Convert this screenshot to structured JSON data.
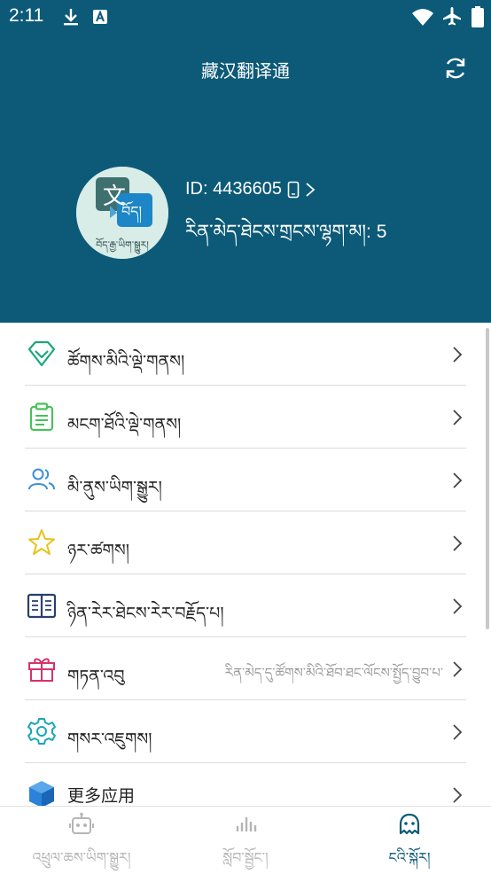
{
  "status_bar": {
    "time": "2:11",
    "icons": [
      "download-icon",
      "a-box-icon",
      "wifi-icon",
      "airplane-icon",
      "battery-icon"
    ]
  },
  "header": {
    "title": "藏汉翻译通",
    "refresh_icon": "refresh-icon",
    "avatar_caption": "བོད་རྒྱ་ཡིག་སྒྱུར།",
    "avatar_icon_chinese": "文",
    "avatar_icon_tibetan": "བོད།",
    "user_id_label": "ID: 4436605",
    "user_points_label": "རིན་མེད་ཐེངས་གྲངས་ལྷག་མ།: 5"
  },
  "menu": {
    "items": [
      {
        "name": "vip-services",
        "icon": "diamond-icon",
        "label": "ཚོགས་མིའི་ལྡེ་གནས།",
        "color": "#1aa77a"
      },
      {
        "name": "purchase-records",
        "icon": "clipboard-icon",
        "label": "མངག་ཐོའི་ལྡེ་གནས།",
        "color": "#49c15a"
      },
      {
        "name": "community",
        "icon": "users-icon",
        "label": "མི་ནུས་ཡིག་སྒྱུར།",
        "color": "#3b8fd6"
      },
      {
        "name": "favorites",
        "icon": "star-icon",
        "label": "ཉར་ཚགས།",
        "color": "#e8c31a"
      },
      {
        "name": "history",
        "icon": "book-icon",
        "label": "ཉིན་རེར་ཐེངས་རེར་བརྗོད་པ།",
        "color": "#2a3f6e"
      },
      {
        "name": "gift",
        "icon": "gift-icon",
        "label": "གཏན་འབུ",
        "extra": "རིན་མེད་དུ་ཚོགས་མིའི་ཐོབ་ཐང་ལོངས་སྤྱོད་བྱུབ་པ་",
        "color": "#d6336c"
      },
      {
        "name": "settings",
        "icon": "gear-icon",
        "label": "གསར་འཇུགས།",
        "color": "#19a7b8"
      },
      {
        "name": "more-apps",
        "icon": "cube-icon",
        "label": "更多应用",
        "color": "#2a83d8"
      }
    ]
  },
  "bottom_nav": {
    "tabs": [
      {
        "label": "འཕྲུལ་ཆས་ཡིག་སྒྱུར།",
        "icon": "robot-icon",
        "active": false
      },
      {
        "label": "སློབ་སྦྱོང་།",
        "icon": "chart-icon",
        "active": false
      },
      {
        "label": "ངའི་སྐོར།",
        "icon": "profile-icon",
        "active": true
      }
    ]
  },
  "colors": {
    "brand": "#0c5a78",
    "inactive_tab": "#b5b5b5"
  }
}
